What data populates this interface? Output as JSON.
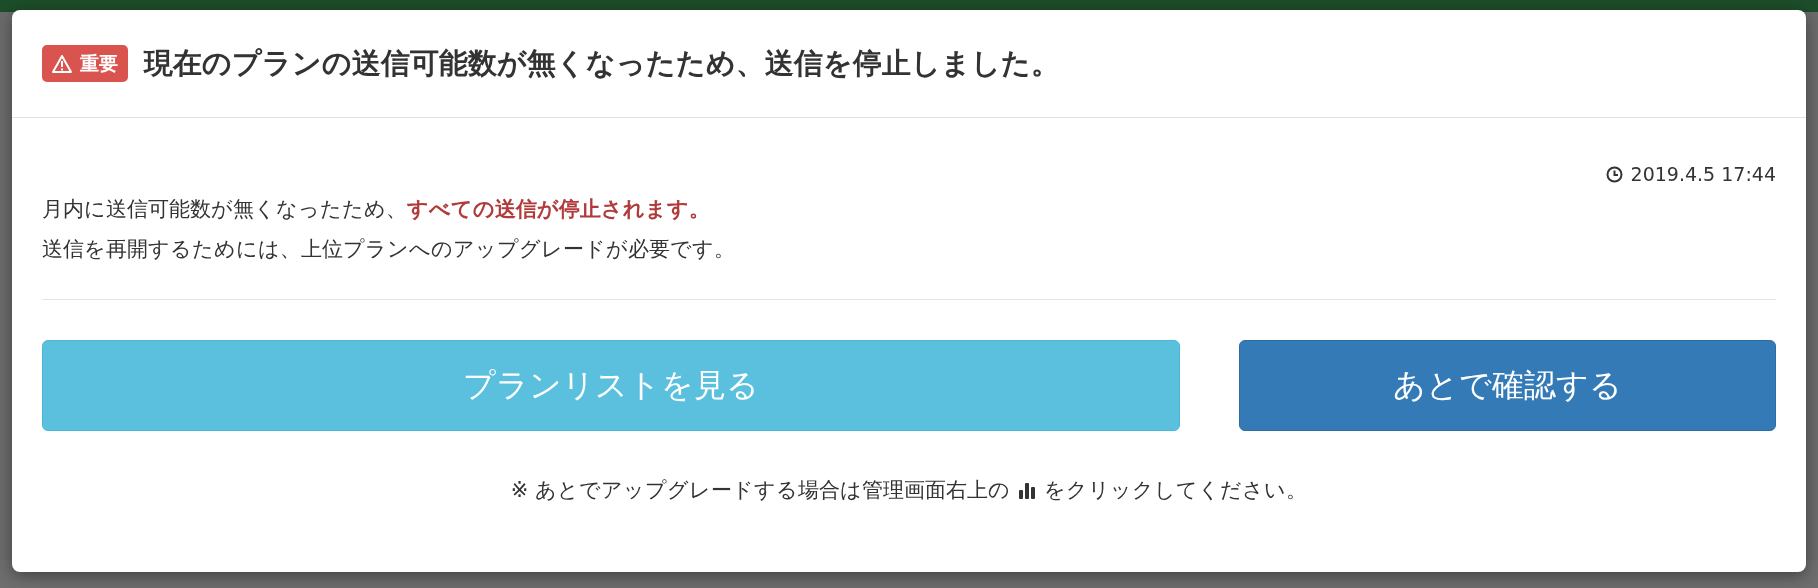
{
  "modal": {
    "badge": "重要",
    "title": "現在のプランの送信可能数が無くなったため、送信を停止しました。",
    "timestamp": "2019.4.5 17:44",
    "message_lines": [
      "月内に送信可能数が無くなったため、**すべての送信が停止されます。**",
      "送信を再開するためには、上位プランへのアップグレードが必要です。"
    ],
    "buttons": [
      {
        "label": "プランリストを見る",
        "kind": "info"
      },
      {
        "label": "あとで確認する",
        "kind": "primary"
      }
    ],
    "note_before": "※ あとでアップグレードする場合は管理画面右上の",
    "note_after": "をクリックしてください。"
  }
}
